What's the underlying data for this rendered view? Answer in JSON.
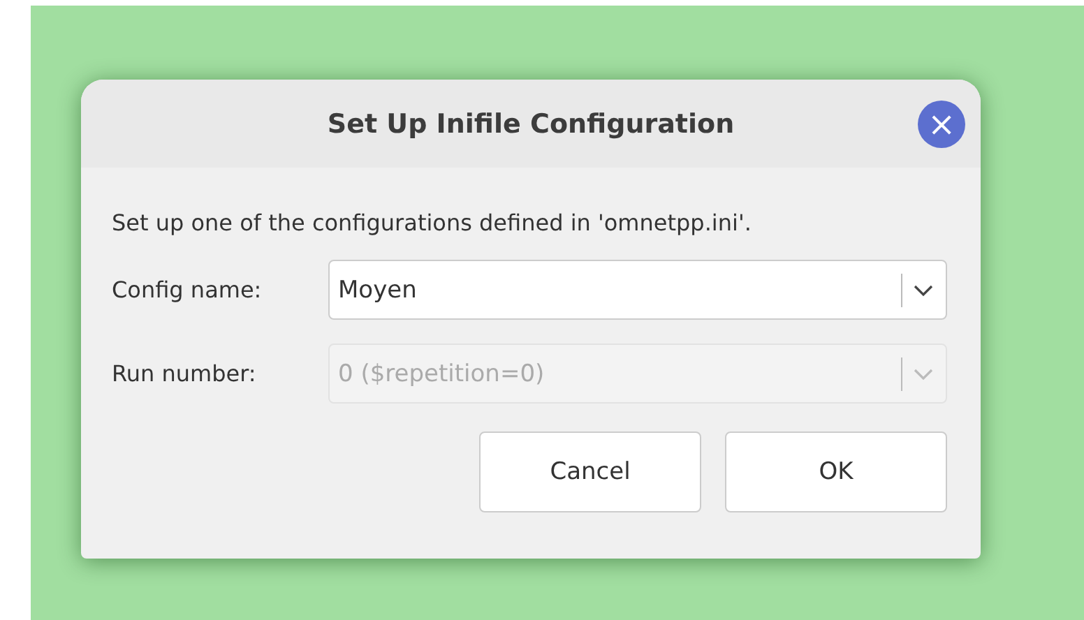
{
  "dialog": {
    "title": "Set Up Inifile Configuration",
    "close": "×",
    "message": "Set up one of the configurations defined in 'omnetpp.ini'.",
    "fields": [
      {
        "label": "Config name:",
        "value": "Moyen",
        "disabled": false
      },
      {
        "label": "Run number:",
        "value": "0 ($repetition=0)",
        "disabled": true
      }
    ],
    "buttons": [
      "Cancel",
      "OK"
    ]
  }
}
